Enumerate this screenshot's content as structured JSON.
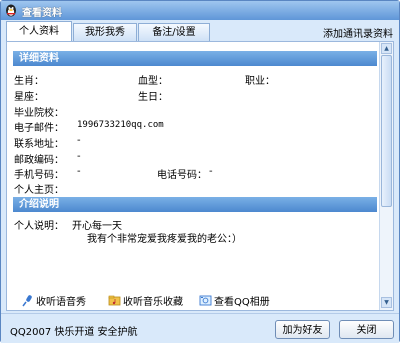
{
  "window": {
    "title": "查看资料"
  },
  "tabs": [
    {
      "label": "个人资料",
      "active": true
    },
    {
      "label": "我形我秀",
      "active": false
    },
    {
      "label": "备注/设置",
      "active": false
    }
  ],
  "add_contact_label": "添加通讯录资料",
  "details": {
    "header": "详细资料",
    "zodiac_label": "生肖：",
    "blood_label": "血型：",
    "job_label": "职业：",
    "constellation_label": "星座：",
    "birthday_label": "生日：",
    "school_label": "毕业院校：",
    "email_label": "电子邮件：",
    "email_value": "1996733210qq.com",
    "address_label": "联系地址：",
    "address_value": "-",
    "postcode_label": "邮政编码：",
    "postcode_value": "-",
    "mobile_label": "手机号码：",
    "mobile_value": "-",
    "phone_label": "电话号码：",
    "phone_value": "-",
    "homepage_label": "个人主页："
  },
  "intro": {
    "header": "介绍说明",
    "label": "个人说明：",
    "line1": "开心每一天",
    "line2": "我有个非常宠爱我疼爱我的老公：）"
  },
  "links": [
    {
      "label": "收听语音秀",
      "icon": "microphone-icon"
    },
    {
      "label": "收听音乐收藏",
      "icon": "music-folder-icon"
    },
    {
      "label": "查看QQ相册",
      "icon": "photo-album-icon"
    }
  ],
  "footer": {
    "brand": "QQ2007  快乐开道  安全护航",
    "add_friend_label": "加为好友",
    "close_label": "关闭"
  },
  "colors": {
    "titlebar": "#5f96d8",
    "section_header": "#4c88cf",
    "window_bg": "#d9e9fa"
  }
}
